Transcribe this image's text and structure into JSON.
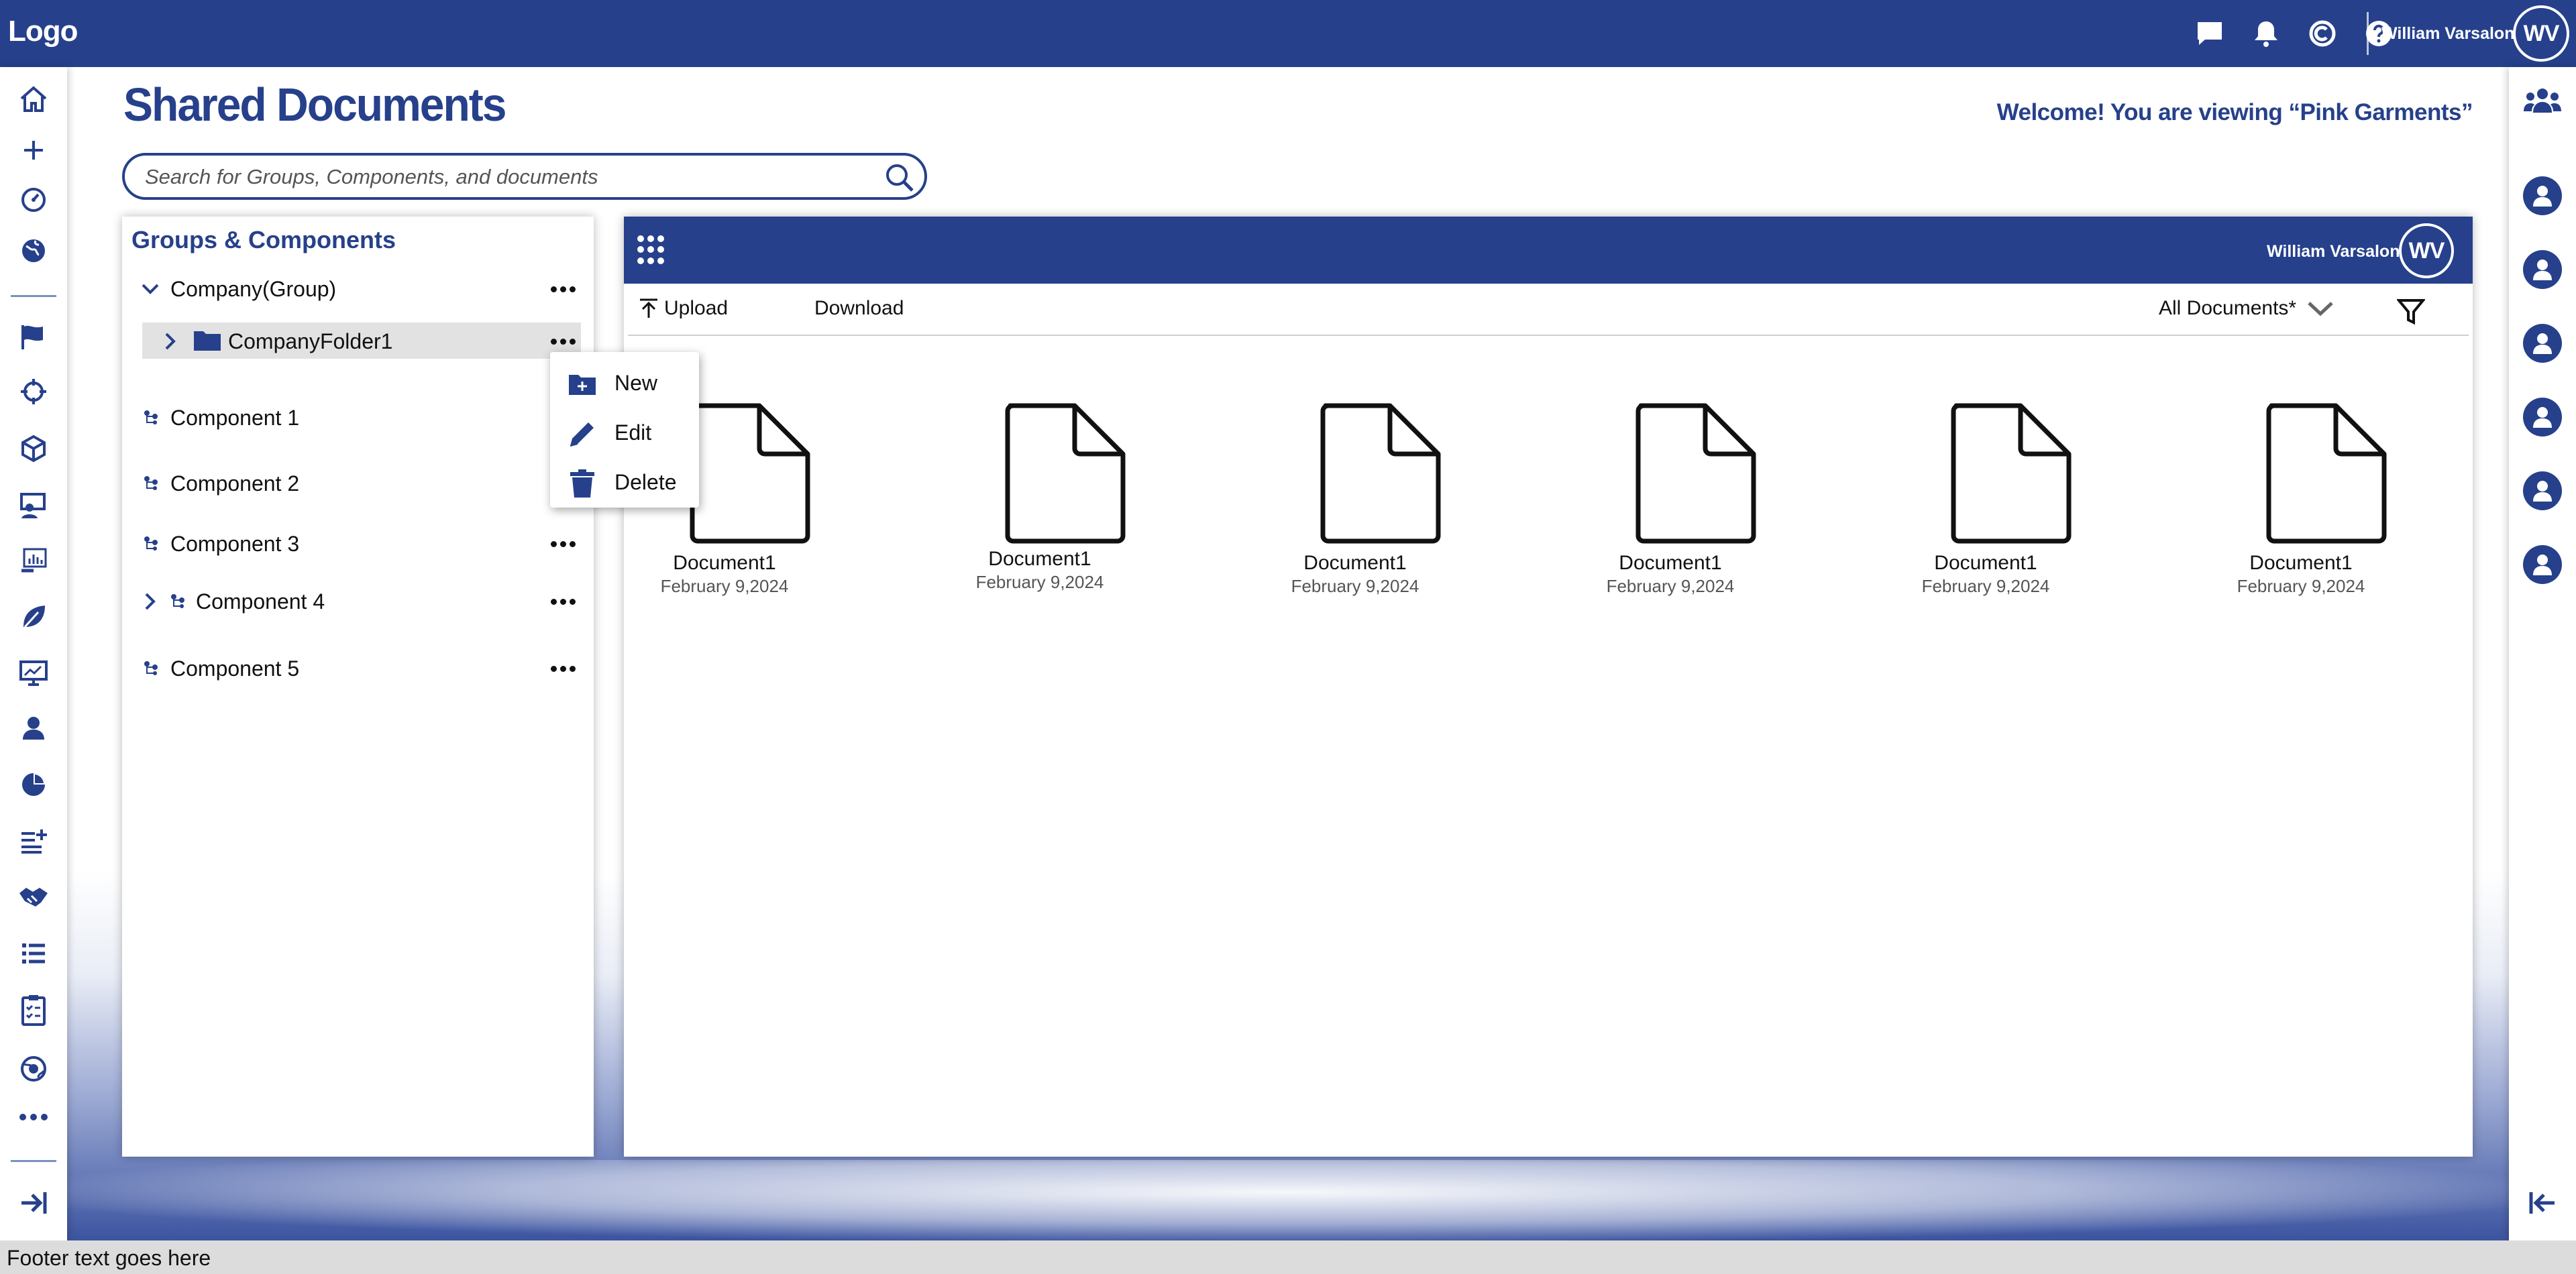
{
  "brand_color": "#26408b",
  "topbar": {
    "logo": "Logo",
    "icons": [
      "chat-icon",
      "bell-icon",
      "c-circle-icon",
      "help-icon"
    ],
    "user_name": "William Varsalona",
    "user_initials": "WV"
  },
  "left_sidebar": {
    "icons": [
      "home-icon",
      "plus-icon",
      "gauge-icon",
      "globe-icon",
      "flag-icon",
      "target-icon",
      "cube-icon",
      "presenter-icon",
      "chart-board-icon",
      "leaf-icon",
      "monitor-chart-icon",
      "user-icon",
      "pie-chart-icon",
      "list-add-icon",
      "handshake-icon",
      "list-icon",
      "clipboard-icon",
      "globe-settings-icon",
      "more-icon"
    ],
    "collapse_icon": "collapse-right-icon"
  },
  "right_sidebar": {
    "icons": [
      "team-icon",
      "person-icon",
      "person-icon",
      "person-icon",
      "person-icon",
      "person-icon",
      "person-icon"
    ],
    "collapse_icon": "collapse-left-icon"
  },
  "page": {
    "title": "Shared Documents",
    "welcome_prefix": "Welcome! You are viewing",
    "welcome_company": "“Pink Garments”",
    "search_placeholder": "Search for Groups, Components, and documents"
  },
  "groups_panel": {
    "title": "Groups & Components",
    "group": "Company(Group)",
    "folder": "CompanyFolder1",
    "components": [
      "Component 1",
      "Component 2",
      "Component 3",
      "Component 4",
      "Component 5"
    ]
  },
  "context_menu": {
    "items": [
      {
        "label": "New",
        "icon": "new-folder-icon"
      },
      {
        "label": "Edit",
        "icon": "pencil-icon"
      },
      {
        "label": "Delete",
        "icon": "trash-icon"
      }
    ]
  },
  "documents_panel": {
    "user_name": "William Varsalona",
    "user_initials": "WV",
    "toolbar": {
      "upload": "Upload",
      "download": "Download",
      "filter_selected": "All Documents*"
    },
    "documents": [
      {
        "name": "Document1",
        "date": "February 9,2024"
      },
      {
        "name": "Document1",
        "date": "February 9,2024"
      },
      {
        "name": "Document1",
        "date": "February 9,2024"
      },
      {
        "name": "Document1",
        "date": "February 9,2024"
      },
      {
        "name": "Document1",
        "date": "February 9,2024"
      },
      {
        "name": "Document1",
        "date": "February 9,2024"
      }
    ]
  },
  "footer": {
    "text": "Footer text goes here"
  }
}
